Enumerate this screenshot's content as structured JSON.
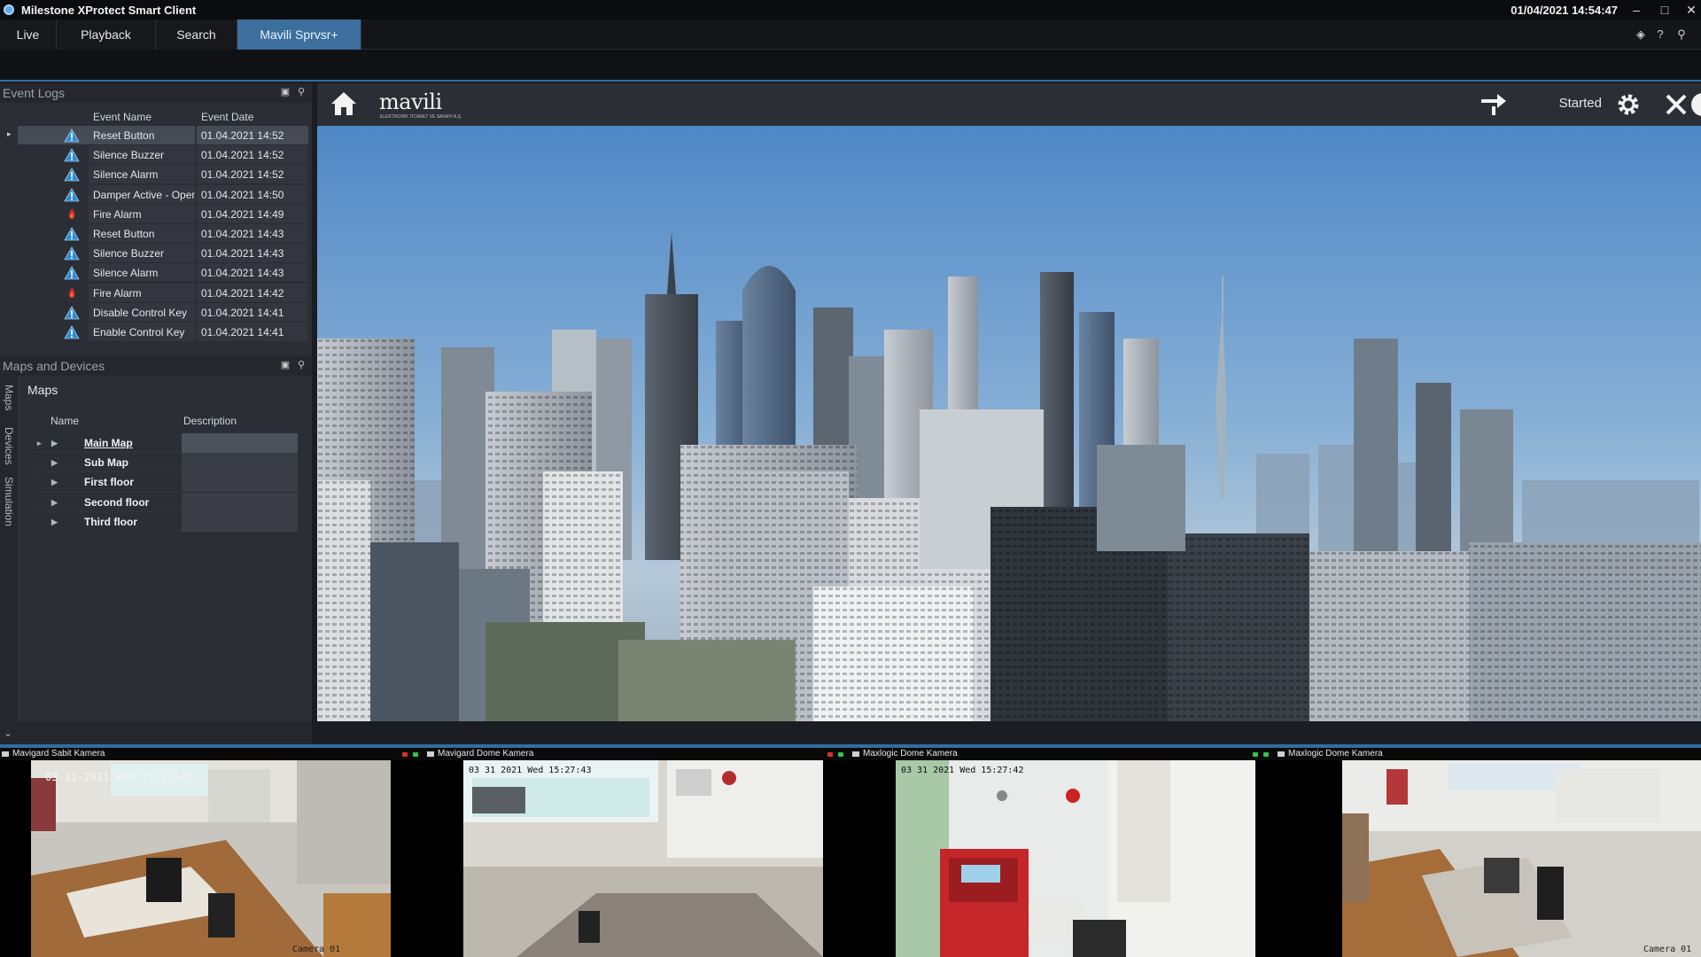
{
  "window": {
    "title": "Milestone XProtect Smart Client",
    "clock": "01/04/2021 14:54:47"
  },
  "tabs": [
    {
      "label": "Live"
    },
    {
      "label": "Playback"
    },
    {
      "label": "Search"
    },
    {
      "label": "Mavili Sprvsr+",
      "active": true
    }
  ],
  "event_logs": {
    "title": "Event Logs",
    "columns": {
      "name": "Event Name",
      "date": "Event Date"
    },
    "rows": [
      {
        "name": "Reset Button",
        "date": "01.04.2021 14:52",
        "type": "warning",
        "selected": true
      },
      {
        "name": "Silence Buzzer",
        "date": "01.04.2021 14:52",
        "type": "warning"
      },
      {
        "name": "Silence Alarm",
        "date": "01.04.2021 14:52",
        "type": "warning"
      },
      {
        "name": "Damper Active - Open",
        "date": "01.04.2021 14:50",
        "type": "warning"
      },
      {
        "name": "Fire Alarm",
        "date": "01.04.2021 14:49",
        "type": "fire"
      },
      {
        "name": "Reset Button",
        "date": "01.04.2021 14:43",
        "type": "warning"
      },
      {
        "name": "Silence Buzzer",
        "date": "01.04.2021 14:43",
        "type": "warning"
      },
      {
        "name": "Silence Alarm",
        "date": "01.04.2021 14:43",
        "type": "warning"
      },
      {
        "name": "Fire Alarm",
        "date": "01.04.2021 14:42",
        "type": "fire"
      },
      {
        "name": "Disable Control Key",
        "date": "01.04.2021 14:41",
        "type": "warning"
      },
      {
        "name": "Enable Control Key",
        "date": "01.04.2021 14:41",
        "type": "warning"
      }
    ]
  },
  "maps_devices": {
    "title": "Maps and Devices",
    "vertical_tabs": [
      "Maps",
      "Devices",
      "Simulation"
    ],
    "maps_title": "Maps",
    "columns": {
      "name": "Name",
      "description": "Description"
    },
    "maps": [
      {
        "name": "Main Map",
        "selected": true
      },
      {
        "name": "Sub Map"
      },
      {
        "name": "First floor"
      },
      {
        "name": "Second floor"
      },
      {
        "name": "Third floor"
      }
    ]
  },
  "main_header": {
    "brand": "mavili",
    "brand_sub": "ELEKTRONİK TİCARET VE SANAYİ A.Ş.",
    "status": "Started",
    "icons": [
      "home-icon",
      "exchange-icon",
      "gear-icon",
      "close-icon",
      "info-icon"
    ]
  },
  "cameras": [
    {
      "title": "Mavigard Sabit Kamera",
      "timestamp": "03-31-2021 Wed 15:27:42",
      "label": "Camera 01"
    },
    {
      "title": "Mavigard Dome Kamera",
      "timestamp": "03 31 2021 Wed 15:27:43",
      "label": ""
    },
    {
      "title": "Maxlogic Dome Kamera",
      "timestamp": "03 31 2021 Wed 15:27:42",
      "label": ""
    },
    {
      "title": "Maxlogic Dome Kamera",
      "timestamp": "",
      "label": "Camera 01"
    }
  ],
  "colors": {
    "accent": "#3c6f9e",
    "panel": "#2b2e35",
    "warning": "#2f8ad1",
    "fire": "#d8322c"
  }
}
